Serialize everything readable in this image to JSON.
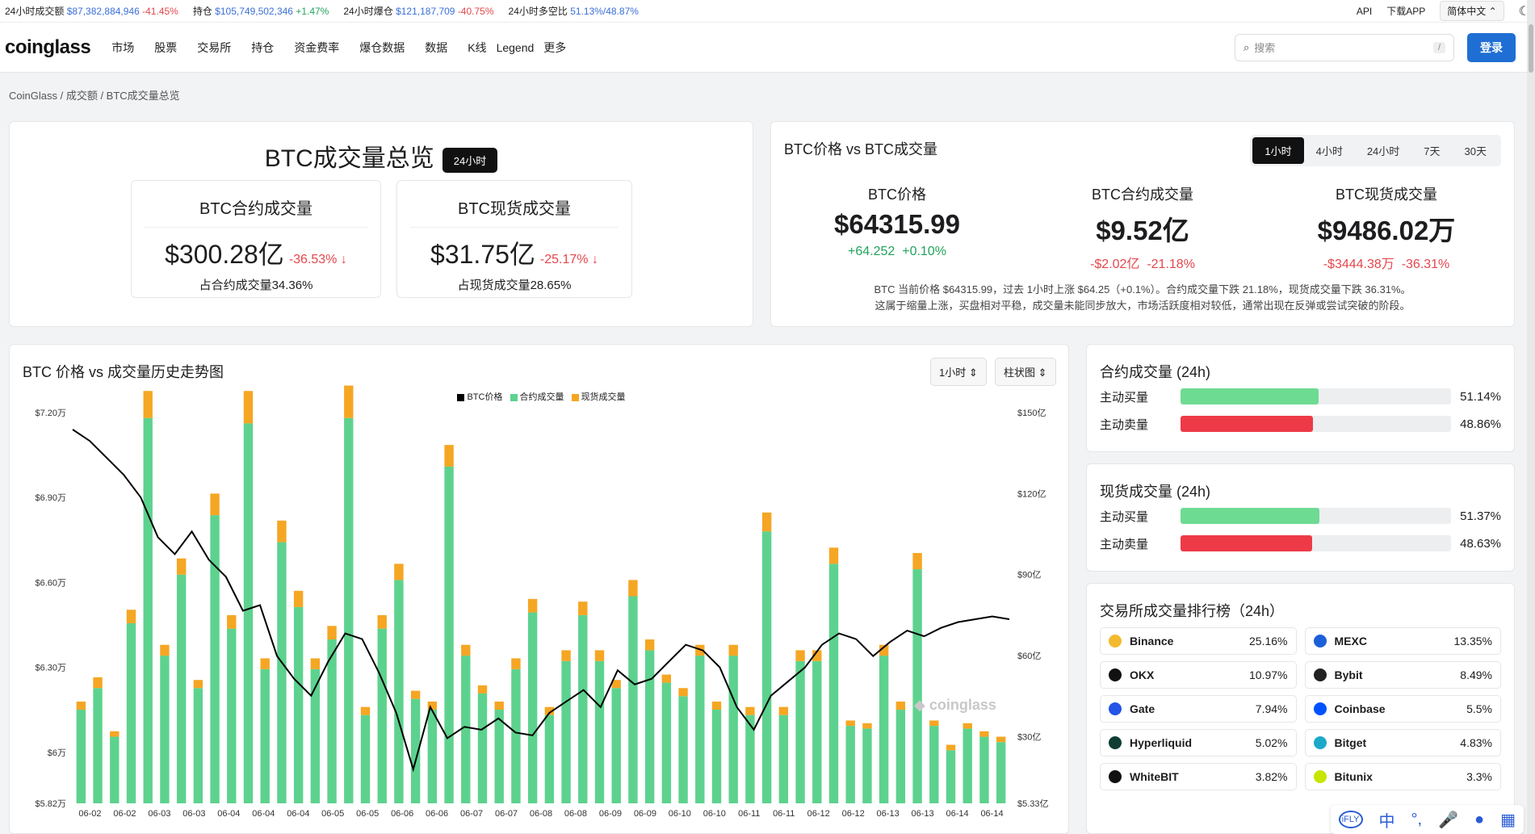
{
  "ticker": {
    "items": [
      {
        "label": "24小时成交额",
        "value": "$87,382,884,946",
        "change": "-41.45%",
        "dir": "down"
      },
      {
        "label": "持仓",
        "value": "$105,749,502,346",
        "change": "+1.47%",
        "dir": "up"
      },
      {
        "label": "24小时爆仓",
        "value": "$121,187,709",
        "change": "-40.75%",
        "dir": "down"
      },
      {
        "label": "24小时多空比",
        "value": "51.13%/48.87%",
        "change": "",
        "dir": ""
      }
    ],
    "api": "API",
    "download": "下载APP",
    "language": "简体中文",
    "theme_icon": "moon-icon"
  },
  "navbar": {
    "logo": "coinglass",
    "items": [
      "市场",
      "股票",
      "交易所",
      "持仓",
      "资金费率",
      "爆仓数据",
      "数据",
      "K线",
      "Legend",
      "更多"
    ],
    "search_placeholder": "搜索",
    "search_shortcut": "/",
    "login": "登录"
  },
  "breadcrumb": [
    "CoinGlass",
    "成交额",
    "BTC成交量总览"
  ],
  "overview": {
    "title": "BTC成交量总览",
    "badge": "24小时",
    "futures": {
      "title": "BTC合约成交量",
      "value": "$300.28亿",
      "change": "-36.53%",
      "arrow": "↓",
      "share": "占合约成交量34.36%"
    },
    "spot": {
      "title": "BTC现货成交量",
      "value": "$31.75亿",
      "change": "-25.17%",
      "arrow": "↓",
      "share": "占现货成交量28.65%"
    }
  },
  "price_vs_volume": {
    "title": "BTC价格 vs BTC成交量",
    "timeframes": [
      "1小时",
      "4小时",
      "24小时",
      "7天",
      "30天"
    ],
    "active_timeframe": "1小时",
    "price": {
      "label": "BTC价格",
      "value": "$64315.99",
      "change_abs": "+64.252",
      "change_pct": "+0.10%"
    },
    "futures": {
      "label": "BTC合约成交量",
      "value": "$9.52亿",
      "change_abs": "-$2.02亿",
      "change_pct": "-21.18%"
    },
    "spot": {
      "label": "BTC现货成交量",
      "value": "$9486.02万",
      "change_abs": "-$3444.38万",
      "change_pct": "-36.31%"
    },
    "description_line1": "BTC 当前价格 $64315.99，过去 1小时上涨 $64.25（+0.1%）。合约成交量下跌 21.18%，现货成交量下跌 36.31%。",
    "description_line2": "这属于缩量上涨，买盘相对平稳，成交量未能同步放大，市场活跃度相对较低，通常出现在反弹或尝试突破的阶段。"
  },
  "history_chart": {
    "title": "BTC 价格 vs 成交量历史走势图",
    "interval_select": "1小时",
    "type_select": "柱状图",
    "watermark": "coinglass"
  },
  "chart_data": {
    "type": "bar",
    "legend": [
      "BTC价格",
      "合约成交量",
      "现货成交量"
    ],
    "colors": {
      "price": "#000000",
      "futures": "#5dd28e",
      "spot": "#f5a623"
    },
    "x_tick_labels": [
      "06-02",
      "06-02",
      "06-03",
      "06-03",
      "06-04",
      "06-04",
      "06-04",
      "06-05",
      "06-05",
      "06-06",
      "06-06",
      "06-07",
      "06-07",
      "06-08",
      "06-08",
      "06-09",
      "06-09",
      "06-10",
      "06-10",
      "06-11",
      "06-11",
      "06-12",
      "06-12",
      "06-13",
      "06-13",
      "06-14",
      "06-14"
    ],
    "y_left_tick_labels": [
      "$7.20万",
      "$6.90万",
      "$6.60万",
      "$6.30万",
      "$6万",
      "$5.82万"
    ],
    "y_left_tick_values": [
      72000,
      69000,
      66000,
      63000,
      60000,
      58200
    ],
    "y_left_range": [
      58200,
      72000
    ],
    "y_right_tick_labels": [
      "$150亿",
      "$120亿",
      "$90亿",
      "$60亿",
      "$30亿",
      "$5.33亿"
    ],
    "y_right_tick_values": [
      150,
      120,
      90,
      60,
      30,
      5.33
    ],
    "y_right_range": [
      5.33,
      150
    ],
    "price_series": {
      "name": "BTC价格",
      "values": [
        71400,
        71000,
        70400,
        69800,
        69000,
        67600,
        67000,
        67800,
        66800,
        66200,
        65000,
        65200,
        63400,
        62600,
        62000,
        63200,
        64200,
        64000,
        62800,
        61400,
        59400,
        61600,
        60500,
        60900,
        60800,
        61200,
        60700,
        60600,
        61400,
        61800,
        62200,
        61600,
        62900,
        62400,
        62600,
        63200,
        63800,
        63600,
        63000,
        61600,
        60800,
        62000,
        62500,
        63000,
        63800,
        64200,
        64000,
        63400,
        63900,
        64300,
        64100,
        64400,
        64600,
        64700,
        64800,
        64700
      ]
    },
    "futures_series": {
      "name": "合约成交量",
      "values": [
        40,
        48,
        30,
        72,
        148,
        60,
        90,
        48,
        112,
        70,
        146,
        55,
        102,
        78,
        55,
        66,
        148,
        38,
        70,
        88,
        44,
        40,
        130,
        60,
        46,
        40,
        55,
        76,
        38,
        58,
        75,
        58,
        48,
        82,
        62,
        50,
        45,
        60,
        40,
        60,
        38,
        106,
        38,
        58,
        58,
        94,
        34,
        33,
        60,
        40,
        92,
        34,
        25,
        33,
        30,
        28
      ]
    },
    "spot_series": {
      "name": "现货成交量",
      "values": [
        3,
        4,
        2,
        5,
        10,
        4,
        6,
        3,
        8,
        5,
        12,
        4,
        8,
        6,
        4,
        5,
        12,
        3,
        5,
        6,
        3,
        3,
        8,
        4,
        3,
        3,
        4,
        5,
        3,
        4,
        5,
        4,
        3,
        6,
        4,
        3,
        3,
        4,
        3,
        4,
        3,
        7,
        3,
        4,
        4,
        6,
        2,
        2,
        4,
        3,
        6,
        2,
        2,
        2,
        2,
        2
      ]
    }
  },
  "futures_taker": {
    "title": "合约成交量 (24h)",
    "rows": [
      {
        "label": "主动买量",
        "pct": "51.14%",
        "fraction": 0.5114,
        "color": "#6edb92"
      },
      {
        "label": "主动卖量",
        "pct": "48.86%",
        "fraction": 0.4886,
        "color": "#ee3a48"
      }
    ]
  },
  "spot_taker": {
    "title": "现货成交量 (24h)",
    "rows": [
      {
        "label": "主动买量",
        "pct": "51.37%",
        "fraction": 0.5137,
        "color": "#6edb92"
      },
      {
        "label": "主动卖量",
        "pct": "48.63%",
        "fraction": 0.4863,
        "color": "#ee3a48"
      }
    ]
  },
  "exchange_rank": {
    "title": "交易所成交量排行榜（24h）",
    "items": [
      {
        "name": "Binance",
        "pct": "25.16%",
        "icon": "binance-icon",
        "color": "#f3ba2f"
      },
      {
        "name": "MEXC",
        "pct": "13.35%",
        "icon": "mexc-icon",
        "color": "#1c5fd9"
      },
      {
        "name": "OKX",
        "pct": "10.97%",
        "icon": "okx-icon",
        "color": "#111111"
      },
      {
        "name": "Bybit",
        "pct": "8.49%",
        "icon": "bybit-icon",
        "color": "#222222"
      },
      {
        "name": "Gate",
        "pct": "7.94%",
        "icon": "gate-icon",
        "color": "#2354e6"
      },
      {
        "name": "Coinbase",
        "pct": "5.5%",
        "icon": "coinbase-icon",
        "color": "#0052ff"
      },
      {
        "name": "Hyperliquid",
        "pct": "5.02%",
        "icon": "hyperliquid-icon",
        "color": "#0f3d33"
      },
      {
        "name": "Bitget",
        "pct": "4.83%",
        "icon": "bitget-icon",
        "color": "#1ca9c9"
      },
      {
        "name": "WhiteBIT",
        "pct": "3.82%",
        "icon": "whitebit-icon",
        "color": "#111111"
      },
      {
        "name": "Bitunix",
        "pct": "3.3%",
        "icon": "bitunix-icon",
        "color": "#c6e600"
      }
    ]
  },
  "floating_toolbar": {
    "items": [
      "iFLY",
      "中",
      "°,",
      "mic",
      "user",
      "grid"
    ]
  }
}
